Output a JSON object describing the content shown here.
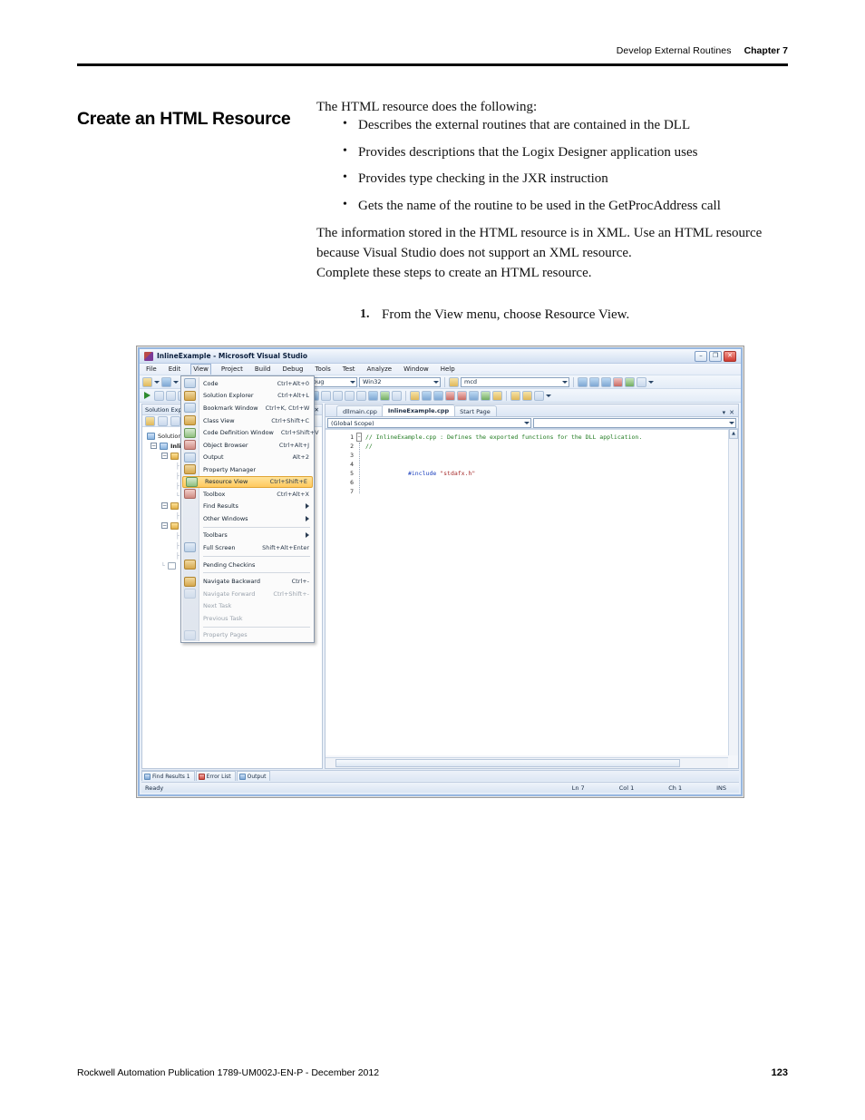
{
  "header": {
    "section": "Develop External Routines",
    "chapter": "Chapter 7"
  },
  "section_title": "Create an HTML Resource",
  "body": {
    "intro": "The HTML resource does the following:",
    "bullets": [
      "Describes the external routines that are contained in the DLL",
      "Provides descriptions that the Logix Designer application uses",
      "Provides type checking in the JXR instruction",
      "Gets the name of the routine to be used in the GetProcAddress call"
    ],
    "para1": "The information stored in the HTML resource is in XML. Use an HTML resource because Visual Studio does not support an XML resource.",
    "para2": "Complete these steps to create an HTML resource.",
    "steps": [
      "From the View menu, choose Resource View."
    ]
  },
  "screenshot": {
    "window_title": "InlineExample - Microsoft Visual Studio",
    "window_controls": {
      "minimize": "–",
      "maximize": "❐",
      "close": "✕"
    },
    "menubar": [
      "File",
      "Edit",
      "View",
      "Project",
      "Build",
      "Debug",
      "Tools",
      "Test",
      "Analyze",
      "Window",
      "Help"
    ],
    "active_menu": "View",
    "toolbar": {
      "config_value": "Debug",
      "platform_value": "Win32",
      "search_value": "mcd"
    },
    "view_menu": {
      "items": [
        {
          "label": "Code",
          "shortcut": "Ctrl+Alt+0",
          "icon": "code-icon",
          "state": "normal"
        },
        {
          "label": "Solution Explorer",
          "shortcut": "Ctrl+Alt+L",
          "icon": "solution-explorer-icon",
          "state": "normal"
        },
        {
          "label": "Bookmark Window",
          "shortcut": "Ctrl+K, Ctrl+W",
          "icon": "bookmark-icon",
          "state": "normal"
        },
        {
          "label": "Class View",
          "shortcut": "Ctrl+Shift+C",
          "icon": "class-view-icon",
          "state": "normal"
        },
        {
          "label": "Code Definition Window",
          "shortcut": "Ctrl+Shift+V",
          "icon": "code-definition-icon",
          "state": "normal"
        },
        {
          "label": "Object Browser",
          "shortcut": "Ctrl+Alt+J",
          "icon": "object-browser-icon",
          "state": "normal"
        },
        {
          "label": "Output",
          "shortcut": "Alt+2",
          "icon": "output-icon",
          "state": "normal"
        },
        {
          "label": "Property Manager",
          "shortcut": "",
          "icon": "property-manager-icon",
          "state": "normal"
        },
        {
          "label": "Resource View",
          "shortcut": "Ctrl+Shift+E",
          "icon": "resource-view-icon",
          "state": "highlighted"
        },
        {
          "label": "Toolbox",
          "shortcut": "Ctrl+Alt+X",
          "icon": "toolbox-icon",
          "state": "normal"
        },
        {
          "label": "Find Results",
          "shortcut": "",
          "icon": "submenu-arrow-icon",
          "state": "submenu"
        },
        {
          "label": "Other Windows",
          "shortcut": "",
          "icon": "submenu-arrow-icon",
          "state": "submenu"
        },
        {
          "label": "Toolbars",
          "shortcut": "",
          "icon": "submenu-arrow-icon",
          "state": "submenu"
        },
        {
          "label": "Full Screen",
          "shortcut": "Shift+Alt+Enter",
          "icon": "full-screen-icon",
          "state": "normal"
        },
        {
          "label": "Pending Checkins",
          "shortcut": "",
          "icon": "pending-checkins-icon",
          "state": "normal"
        },
        {
          "label": "Navigate Backward",
          "shortcut": "Ctrl+-",
          "icon": "navigate-backward-icon",
          "state": "normal"
        },
        {
          "label": "Navigate Forward",
          "shortcut": "Ctrl+Shift+-",
          "icon": "navigate-forward-icon",
          "state": "disabled"
        },
        {
          "label": "Next Task",
          "shortcut": "",
          "icon": "next-task-icon",
          "state": "disabled"
        },
        {
          "label": "Previous Task",
          "shortcut": "",
          "icon": "previous-task-icon",
          "state": "disabled"
        },
        {
          "label": "Property Pages",
          "shortcut": "",
          "icon": "property-pages-icon",
          "state": "disabled"
        }
      ]
    },
    "solution_explorer": {
      "title": "Solution Explo",
      "root": "Solution",
      "project": "Inli"
    },
    "editor": {
      "tabs": [
        {
          "label": "dllmain.cpp",
          "active": false
        },
        {
          "label": "InlineExample.cpp",
          "active": true
        },
        {
          "label": "Start Page",
          "active": false
        }
      ],
      "scope_value": "(Global Scope)",
      "line_numbers": [
        "1",
        "2",
        "3",
        "4",
        "5",
        "6",
        "7"
      ],
      "code_lines": [
        "// InlineExample.cpp : Defines the exported functions for the DLL application.",
        "//",
        "",
        "#include \"stdafx.h\"",
        "",
        "",
        ""
      ],
      "include_directive": "#include",
      "include_file": "\"stdafx.h\""
    },
    "bottom_tabs": [
      {
        "label": "Find Results 1",
        "icon": "find-results-icon"
      },
      {
        "label": "Error List",
        "icon": "error-list-icon"
      },
      {
        "label": "Output",
        "icon": "output-icon"
      }
    ],
    "status_bar": {
      "state": "Ready",
      "line": "Ln 7",
      "col": "Col 1",
      "ch": "Ch 1",
      "insert": "INS"
    }
  },
  "footer": {
    "publication": "Rockwell Automation Publication 1789-UM002J-EN-P - December 2012",
    "page_number": "123"
  }
}
